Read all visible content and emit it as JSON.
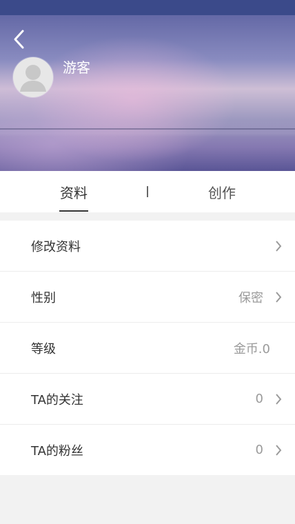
{
  "header": {
    "user_name": "游客"
  },
  "tabs": [
    {
      "label": "资料"
    },
    {
      "label": "创作"
    }
  ],
  "list": [
    {
      "label": "修改资料",
      "value": ""
    },
    {
      "label": "性别",
      "value": "保密"
    },
    {
      "label": "等级",
      "value": "金币.0"
    },
    {
      "label": "TA的关注",
      "value": "0"
    },
    {
      "label": "TA的粉丝",
      "value": "0"
    }
  ],
  "icons": {
    "back": "back-arrow-icon",
    "avatar": "user-avatar-icon",
    "chevron": "chevron-right-icon"
  },
  "colors": {
    "header_overlay": "#3b4a8a",
    "active_text": "#333333",
    "muted_text": "#9a9a9a"
  }
}
